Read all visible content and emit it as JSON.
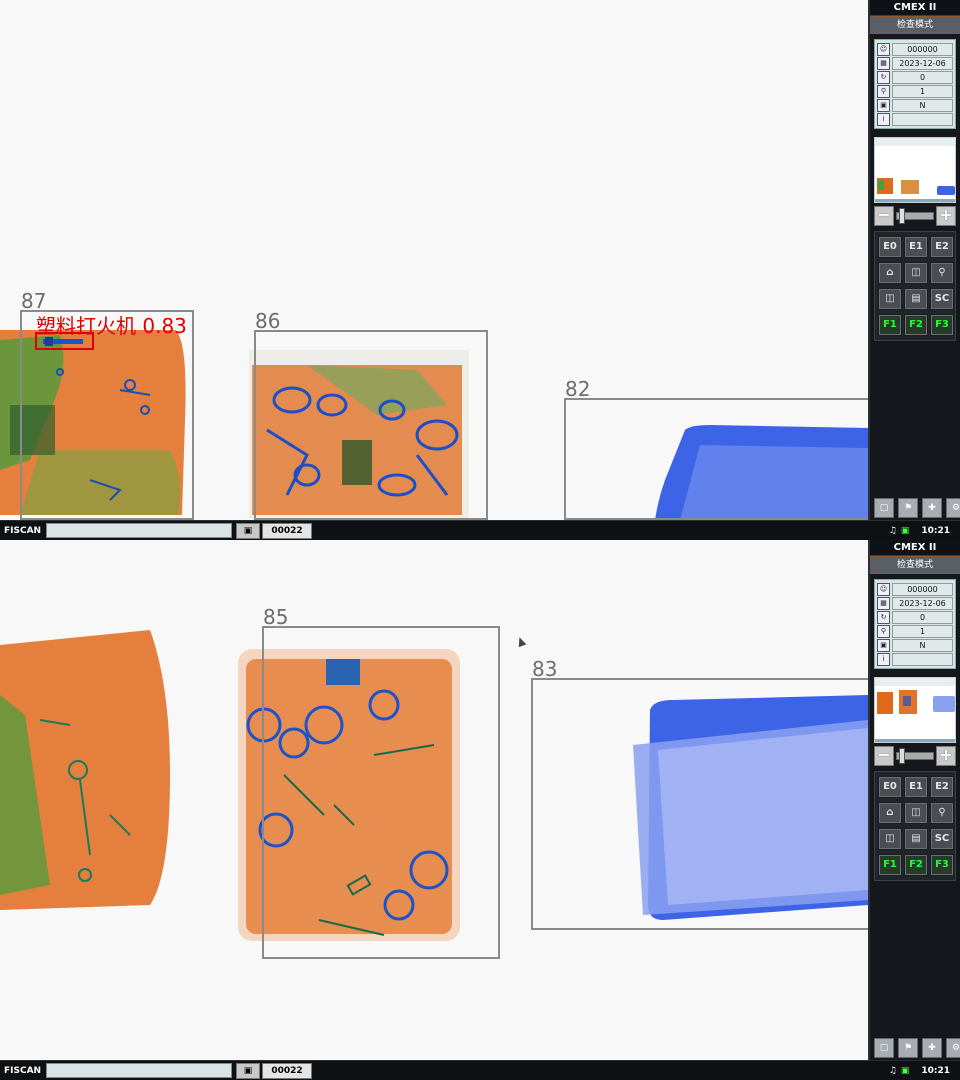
{
  "panes": [
    {
      "app_title": "CMEX II",
      "mode": "检查模式",
      "info": [
        {
          "icon": "user-icon",
          "value": "000000"
        },
        {
          "icon": "calendar-icon",
          "value": "2023-12-06"
        },
        {
          "icon": "counter-icon",
          "value": "0"
        },
        {
          "icon": "zoom-level-icon",
          "value": "1"
        },
        {
          "icon": "network-icon",
          "value": "N"
        },
        {
          "icon": "info-icon",
          "value": ""
        }
      ],
      "scan_boxes": [
        {
          "number": "87"
        },
        {
          "number": "86"
        },
        {
          "number": "82"
        }
      ],
      "detection": {
        "label": "塑料打火机 0.83"
      },
      "function_buttons": [
        "E0",
        "E1",
        "E2",
        "home",
        "split",
        "magnify",
        "compare",
        "adjust",
        "SC",
        "F1",
        "F2",
        "F3"
      ],
      "taskbar": {
        "brand": "FISCAN",
        "bag_count": "00022",
        "time": "10:21"
      }
    },
    {
      "app_title": "CMEX II",
      "mode": "检查模式",
      "info": [
        {
          "icon": "user-icon",
          "value": "000000"
        },
        {
          "icon": "calendar-icon",
          "value": "2023-12-06"
        },
        {
          "icon": "counter-icon",
          "value": "0"
        },
        {
          "icon": "zoom-level-icon",
          "value": "1"
        },
        {
          "icon": "network-icon",
          "value": "N"
        },
        {
          "icon": "info-icon",
          "value": ""
        }
      ],
      "scan_boxes": [
        {
          "number": "85"
        },
        {
          "number": "83"
        }
      ],
      "function_buttons": [
        "E0",
        "E1",
        "E2",
        "home",
        "split",
        "magnify",
        "compare",
        "adjust",
        "SC",
        "F1",
        "F2",
        "F3"
      ],
      "taskbar": {
        "brand": "FISCAN",
        "bag_count": "00022",
        "time": "10:21"
      }
    }
  ],
  "colors": {
    "detection": "#e00000",
    "box": "#8a8a8a",
    "accent_green": "#22ff33",
    "organic_orange": "#e0701f",
    "metal_blue": "#2050d0",
    "mixed_green": "#4aa040"
  }
}
